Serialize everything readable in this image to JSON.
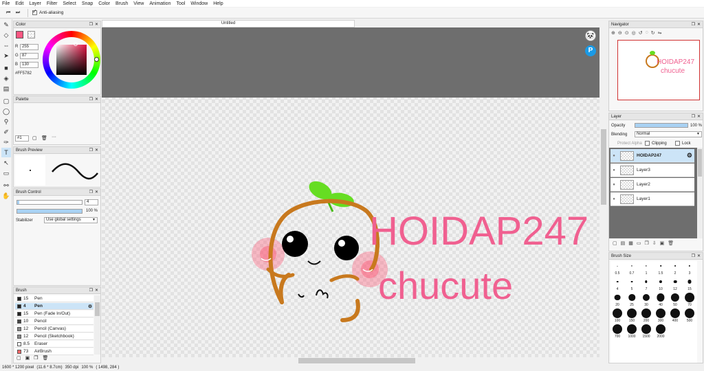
{
  "menu": [
    "File",
    "Edit",
    "Layer",
    "Filter",
    "Select",
    "Snap",
    "Color",
    "Brush",
    "View",
    "Animation",
    "Tool",
    "Window",
    "Help"
  ],
  "toolbar": {
    "antialias_label": "Anti-aliasing"
  },
  "color_panel": {
    "title": "Color",
    "r_label": "R",
    "r_value": "255",
    "g_label": "G",
    "g_value": "87",
    "b_label": "B",
    "b_value": "130",
    "hex": "#FF5782",
    "primary_color": "#FF5782",
    "secondary_color": "#FFFFFF"
  },
  "palette_panel": {
    "title": "Palette",
    "selector": "#1"
  },
  "brush_preview_panel": {
    "title": "Brush Preview"
  },
  "brush_control_panel": {
    "title": "Brush Control",
    "size_value": "4",
    "opacity_value": "100 %",
    "opacity_fraction": 1.0,
    "size_fraction": 0.03,
    "stabilizer_label": "Stabilizer",
    "stabilizer_value": "Use global settings"
  },
  "brush_panel": {
    "title": "Brush",
    "items": [
      {
        "size": "15",
        "name": "Pen",
        "color": "#222222"
      },
      {
        "size": "4",
        "name": "Pen",
        "color": "#222222",
        "selected": true
      },
      {
        "size": "15",
        "name": "Pen (Fade In/Out)",
        "color": "#222222"
      },
      {
        "size": "10",
        "name": "Pencil",
        "color": "#444444"
      },
      {
        "size": "12",
        "name": "Pencil (Canvas)",
        "color": "#888888"
      },
      {
        "size": "12",
        "name": "Pencil (Sketchbook)",
        "color": "#888888"
      },
      {
        "size": "8.5",
        "name": "Eraser",
        "color": "#ffffff"
      },
      {
        "size": "73",
        "name": "AirBrush",
        "color": "#ff6666"
      }
    ]
  },
  "document": {
    "tab_title": "Untitled",
    "line1": "HOIDAP247",
    "line2": "chucute",
    "text_color": "#F06090"
  },
  "navigator_panel": {
    "title": "Navigator",
    "thumb_line1": "HOIDAP247",
    "thumb_line2": "chucute"
  },
  "layer_panel": {
    "title": "Layer",
    "opacity_label": "Opacity",
    "opacity_value": "100 %",
    "blending_label": "Blending",
    "blending_value": "Normal",
    "protect_alpha": "Protect Alpha",
    "clipping": "Clipping",
    "lock": "Lock",
    "layers": [
      {
        "name": "HOIDAP247",
        "selected": true
      },
      {
        "name": "Layer3"
      },
      {
        "name": "Layer2"
      },
      {
        "name": "Layer1"
      }
    ]
  },
  "brush_size_panel": {
    "title": "Brush Size",
    "sizes": [
      "0.5",
      "0.7",
      "1",
      "1.5",
      "2",
      "3",
      "4",
      "5",
      "7",
      "10",
      "12",
      "15",
      "20",
      "25",
      "30",
      "40",
      "50",
      "70",
      "100",
      "150",
      "200",
      "300",
      "400",
      "500",
      "700",
      "1000",
      "1500",
      "2000"
    ]
  },
  "status": {
    "size": "1600 * 1200 pixel",
    "cm": "(11.6 * 8.7cm)",
    "dpi": "350 dpi",
    "zoom": "100 %",
    "coords": "( 1498, 284 )"
  }
}
